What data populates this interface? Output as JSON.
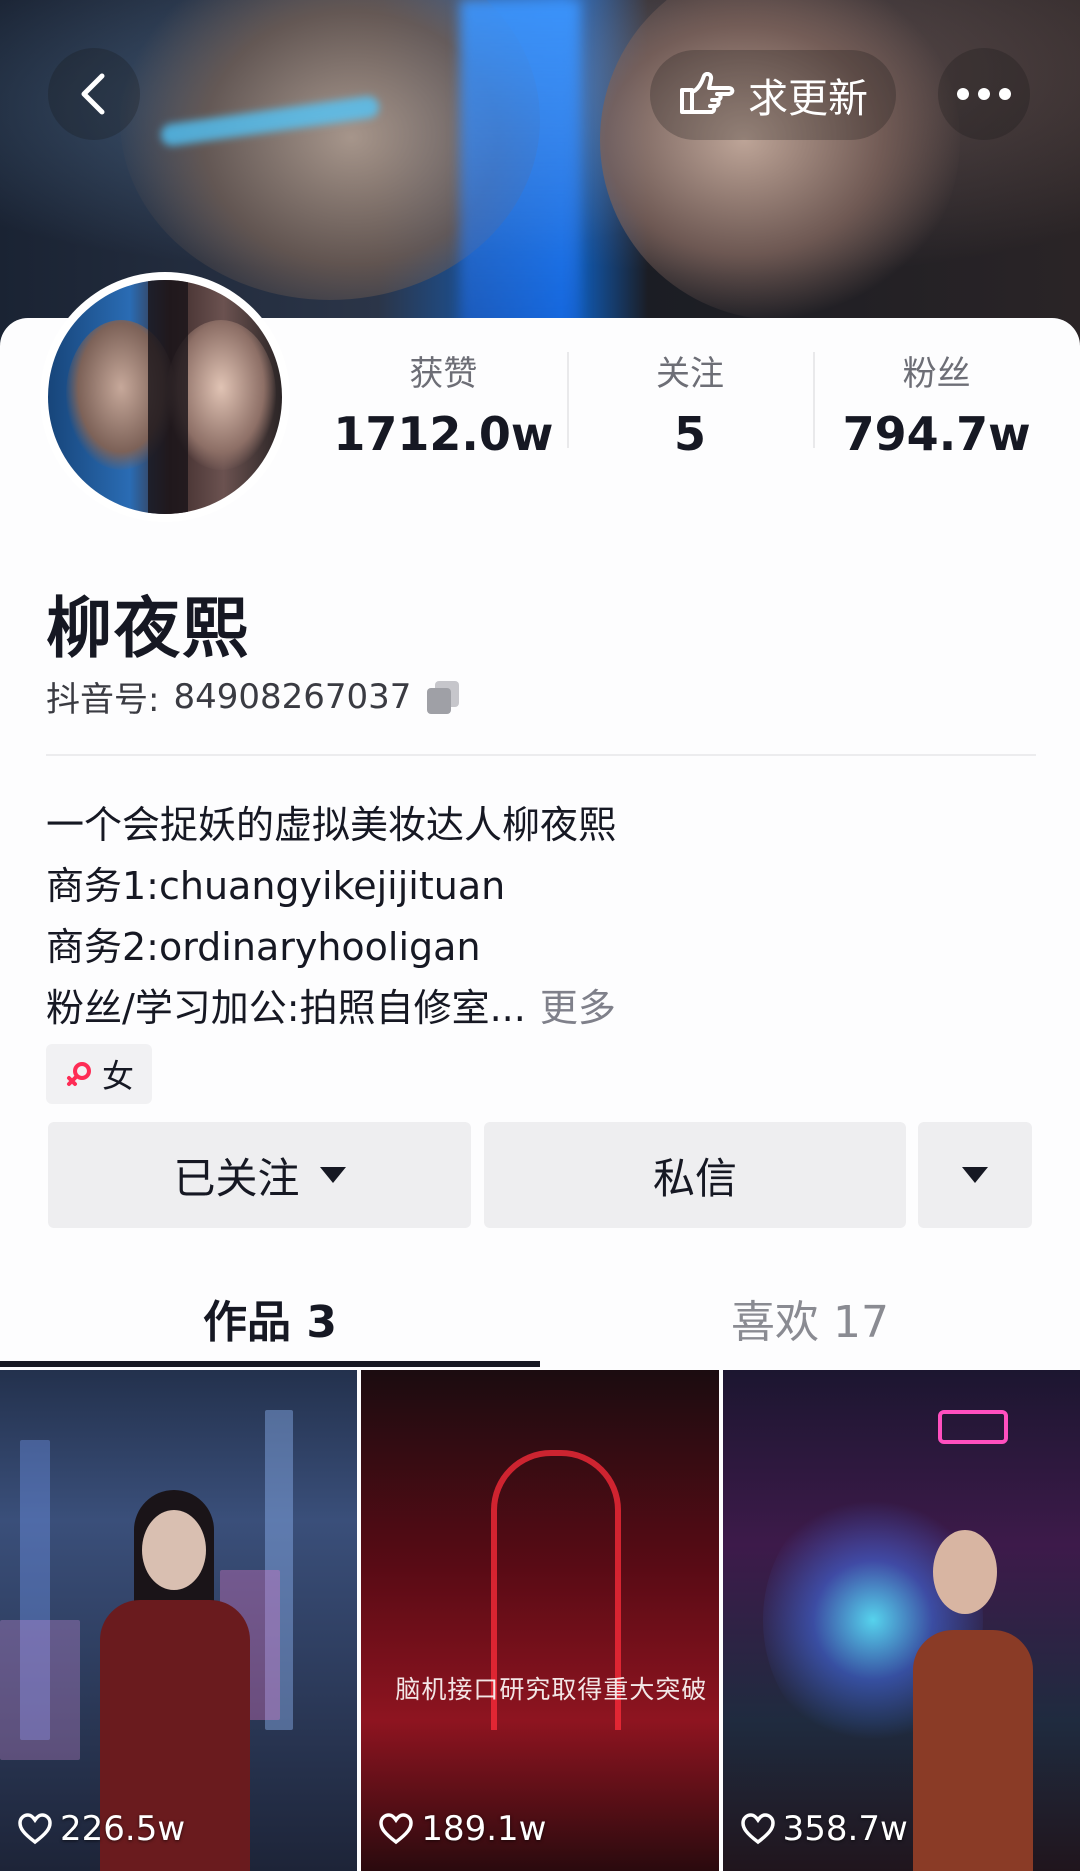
{
  "header": {
    "update_label": "求更新"
  },
  "stats": [
    {
      "label": "获赞",
      "value": "1712.0w"
    },
    {
      "label": "关注",
      "value": "5"
    },
    {
      "label": "粉丝",
      "value": "794.7w"
    }
  ],
  "profile": {
    "name": "柳夜熙",
    "account_label": "抖音号:",
    "account_id": "84908267037",
    "bio_lines": [
      "一个会捉妖的虚拟美妆达人柳夜熙",
      "商务1:chuangyikejijituan",
      "商务2:ordinaryhooligan",
      "粉丝/学习加公:拍照自修室..."
    ],
    "bio_more": "更多",
    "gender": "女"
  },
  "actions": {
    "follow_label": "已关注",
    "message_label": "私信"
  },
  "tabs": [
    {
      "label": "作品 3",
      "active": true
    },
    {
      "label": "喜欢 17",
      "active": false
    }
  ],
  "videos": [
    {
      "likes": "226.5w"
    },
    {
      "likes": "189.1w",
      "caption": "脑机接口研究取得重大突破"
    },
    {
      "likes": "358.7w"
    }
  ],
  "colors": {
    "text_primary": "#161823",
    "text_secondary": "#6d6e76",
    "button_bg": "#eeeef0",
    "gender_icon": "#fe2c55"
  }
}
